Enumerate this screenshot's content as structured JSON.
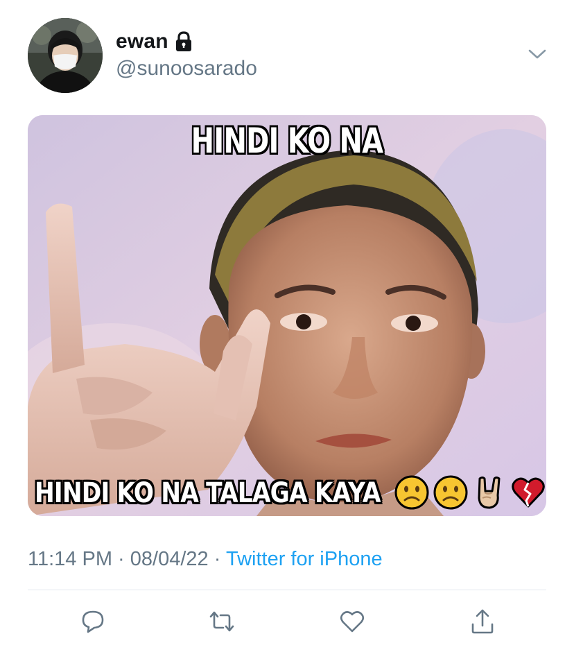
{
  "tweet": {
    "author": {
      "display_name": "ewan",
      "handle": "@sunoosarado",
      "avatar_icon": "avatar-photo",
      "protected_icon": "lock-icon"
    },
    "more_icon": "chevron-down-icon",
    "media": {
      "top_caption": "HINDI KO NA",
      "bottom_caption": "HINDI KO NA TALAGA KAYA",
      "emojis": [
        "frowning-face-emoji",
        "frowning-face-emoji",
        "rock-on-hand-emoji",
        "broken-heart-emoji"
      ]
    },
    "meta": {
      "time": "11:14 PM",
      "separator": "·",
      "date": "08/04/22",
      "source": "Twitter for iPhone"
    },
    "actions": [
      "reply-icon",
      "retweet-icon",
      "like-icon",
      "share-icon"
    ]
  },
  "colors": {
    "text_primary": "#14171a",
    "text_secondary": "#657786",
    "link": "#1da1f2",
    "divider": "#e1e8ed"
  }
}
